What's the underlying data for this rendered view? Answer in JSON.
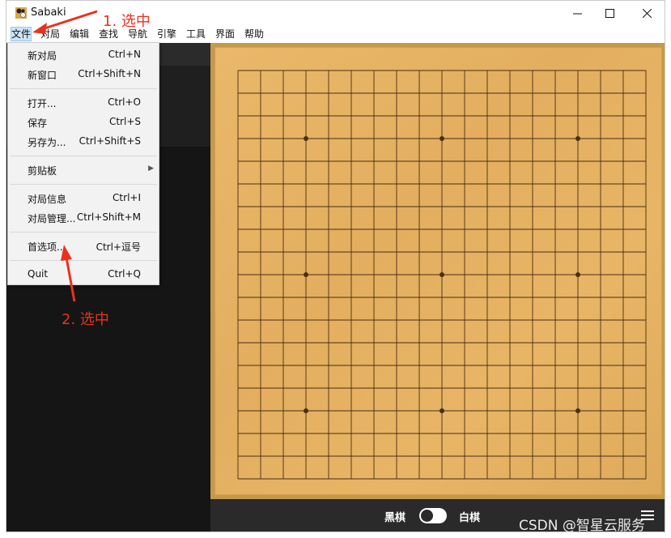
{
  "app": {
    "title": "Sabaki"
  },
  "menubar": {
    "items": [
      "文件",
      "对局",
      "编辑",
      "查找",
      "导航",
      "引擎",
      "工具",
      "界面",
      "帮助"
    ]
  },
  "file_menu": {
    "new_game": {
      "label": "新对局",
      "shortcut": "Ctrl+N"
    },
    "new_window": {
      "label": "新窗口",
      "shortcut": "Ctrl+Shift+N"
    },
    "open": {
      "label": "打开...",
      "shortcut": "Ctrl+O"
    },
    "save": {
      "label": "保存",
      "shortcut": "Ctrl+S"
    },
    "save_as": {
      "label": "另存为...",
      "shortcut": "Ctrl+Shift+S"
    },
    "clipboard": {
      "label": "剪贴板"
    },
    "game_info": {
      "label": "对局信息",
      "shortcut": "Ctrl+I"
    },
    "manage_games": {
      "label": "对局管理...",
      "shortcut": "Ctrl+Shift+M"
    },
    "preferences": {
      "label": "首选项...",
      "shortcut": "Ctrl+逗号"
    },
    "quit": {
      "label": "Quit",
      "shortcut": "Ctrl+Q"
    }
  },
  "bottombar": {
    "black_label": "黑棋",
    "white_label": "白棋"
  },
  "annotations": {
    "step1": "1. 选中",
    "step2": "2. 选中"
  },
  "watermark": "CSDN @智星云服务",
  "board": {
    "size": 19,
    "star_points": [
      "D4",
      "K4",
      "Q4",
      "D10",
      "K10",
      "Q10",
      "D16",
      "K16",
      "Q16"
    ]
  },
  "colors": {
    "annotation": "#e8321e",
    "board": "#e6b365",
    "sidebar": "#151515",
    "bottombar": "#2a2a2a"
  }
}
